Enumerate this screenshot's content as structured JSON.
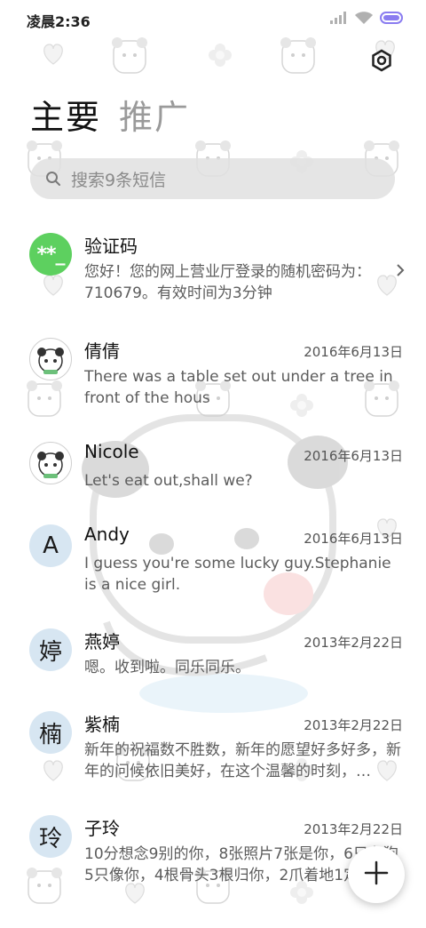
{
  "status_bar": {
    "time": "凌晨2:36",
    "icons": [
      "signal-icon",
      "wifi-icon",
      "battery-icon"
    ]
  },
  "header": {
    "settings_icon": "settings-icon",
    "tabs": [
      {
        "label": "主要",
        "active": true
      },
      {
        "label": "推广",
        "active": false
      }
    ]
  },
  "search": {
    "placeholder": "搜索9条短信"
  },
  "conversations": [
    {
      "avatar_type": "letter-green",
      "avatar_text": "**_",
      "name": "验证码",
      "date": "",
      "preview": "您好！您的网上营业厅登录的随机密码为：710679。有效时间为3分钟"
    },
    {
      "avatar_type": "photo",
      "avatar_text": "",
      "name": "倩倩",
      "date": "2016年6月13日",
      "preview": "There was a table set out under a tree in front of the hous"
    },
    {
      "avatar_type": "photo",
      "avatar_text": "",
      "name": "Nicole",
      "date": "2016年6月13日",
      "preview": "Let's eat out,shall we?"
    },
    {
      "avatar_type": "letter",
      "avatar_text": "A",
      "name": "Andy",
      "date": "2016年6月13日",
      "preview": "I guess you're some lucky guy.Stephanie is a nice girl."
    },
    {
      "avatar_type": "letter",
      "avatar_text": "婷",
      "name": "燕婷",
      "date": "2013年2月22日",
      "preview": "嗯。收到啦。同乐同乐。"
    },
    {
      "avatar_type": "letter",
      "avatar_text": "楠",
      "name": "紫楠",
      "date": "2013年2月22日",
      "preview": "新年的祝福数不胜数，新年的愿望好多好多，新年的问候依旧美好，在这个温馨的时刻，…"
    },
    {
      "avatar_type": "letter",
      "avatar_text": "玲",
      "name": "子玲",
      "date": "2013年2月22日",
      "preview": "10分想念9别的你，8张照片7张是你，6只有狗5只像你，4根骨头3根归你，2爪着地1定是你"
    }
  ],
  "fab": {
    "icon": "plus-icon"
  },
  "colors": {
    "green_avatar": "#5dd05f",
    "letter_avatar": "#d7e6f2",
    "search_bg": "#e1e1e1",
    "battery": "#8a7cf0"
  }
}
